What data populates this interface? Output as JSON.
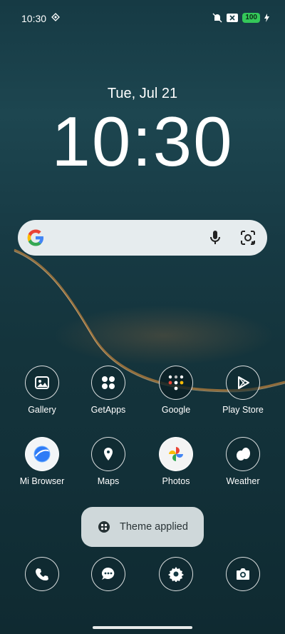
{
  "status_bar": {
    "time": "10:30",
    "battery": "100"
  },
  "lockscreen": {
    "date": "Tue, Jul 21",
    "time": "10:30"
  },
  "apps_row1": [
    {
      "label": "Gallery"
    },
    {
      "label": "GetApps"
    },
    {
      "label": "Google"
    },
    {
      "label": "Play Store"
    }
  ],
  "apps_row2": [
    {
      "label": "Mi Browser"
    },
    {
      "label": "Maps"
    },
    {
      "label": "Photos"
    },
    {
      "label": "Weather"
    }
  ],
  "toast": {
    "text": "Theme applied"
  },
  "colors": {
    "battery_green": "#34c759",
    "search_bg": "#e6ecee",
    "toast_bg": "#cfd8da"
  }
}
